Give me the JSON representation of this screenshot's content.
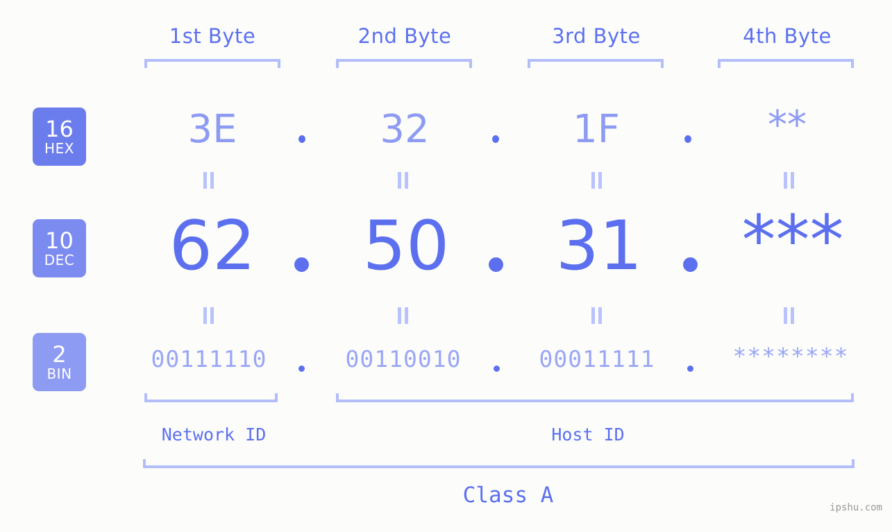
{
  "background_color": "#fcfdfa",
  "accent_color": "#5c70ef",
  "accent_light_color": "#8e9bf3",
  "bracket_color": "#b3bdfa",
  "byte_headers": [
    {
      "label": "1st Byte"
    },
    {
      "label": "2nd Byte"
    },
    {
      "label": "3rd Byte"
    },
    {
      "label": "4th Byte"
    }
  ],
  "rows": [
    {
      "badge_number": "16",
      "badge_name": "HEX",
      "badge_color": "#6b7ced",
      "values": [
        "3E",
        "32",
        "1F",
        "**"
      ],
      "separator": "."
    },
    {
      "badge_number": "10",
      "badge_name": "DEC",
      "badge_color": "#7c8bf0",
      "values": [
        "62",
        "50",
        "31",
        "***"
      ],
      "separator": "."
    },
    {
      "badge_number": "2",
      "badge_name": "BIN",
      "badge_color": "#8e9bf3",
      "values": [
        "00111110",
        "00110010",
        "00011111",
        "********"
      ],
      "separator": "."
    }
  ],
  "equals_symbol": "=",
  "sections": [
    {
      "label": "Network ID"
    },
    {
      "label": "Host ID"
    }
  ],
  "class_label": "Class A",
  "watermark": "ipshu.com"
}
